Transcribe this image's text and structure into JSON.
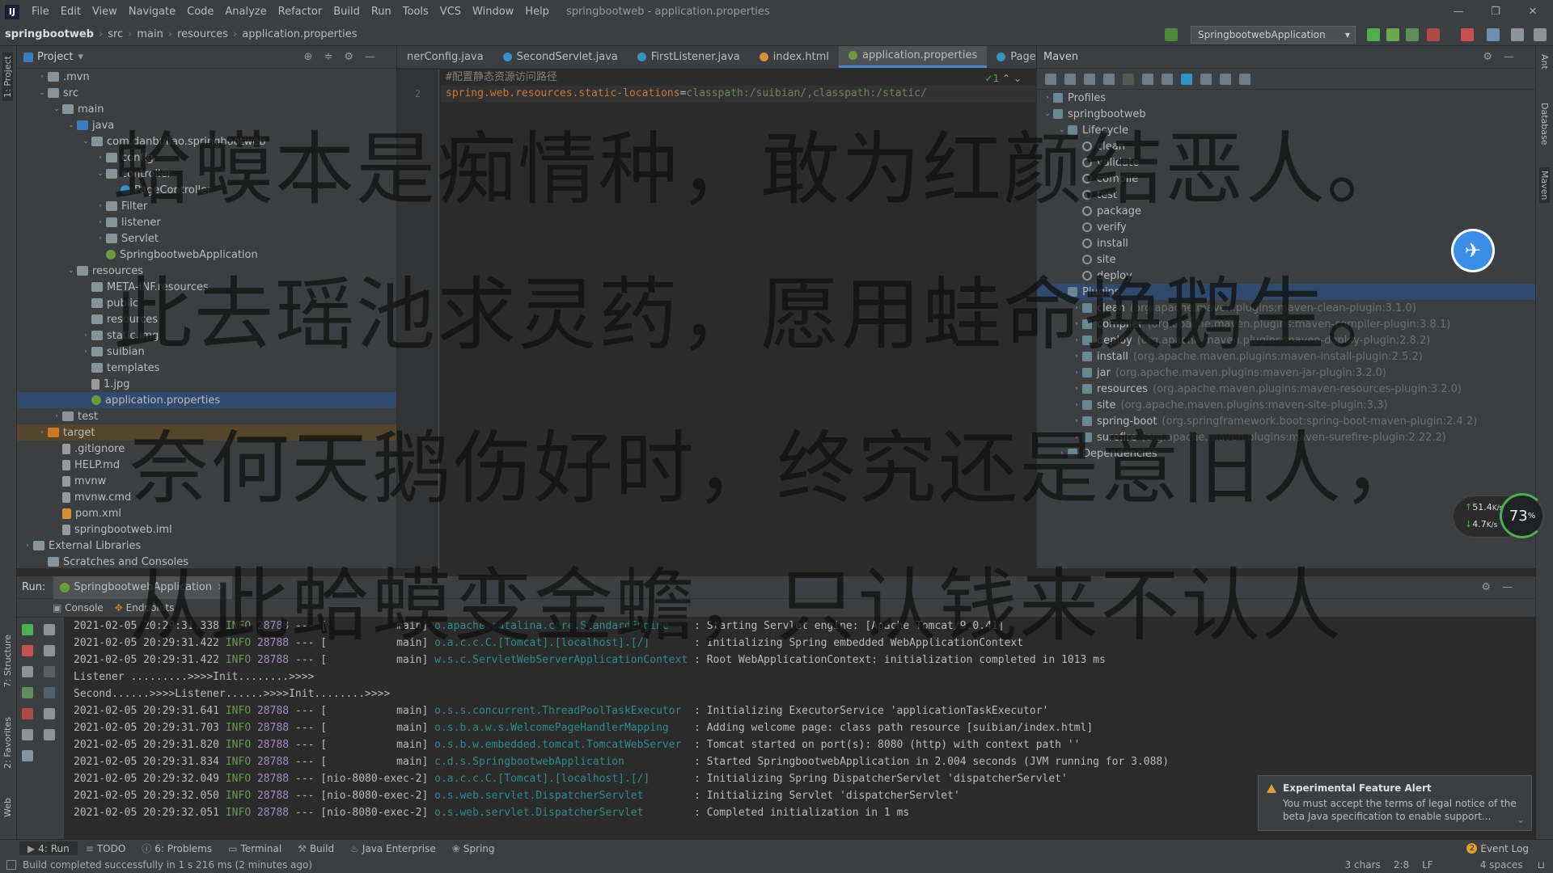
{
  "menubar": {
    "items": [
      "File",
      "Edit",
      "View",
      "Navigate",
      "Code",
      "Analyze",
      "Refactor",
      "Build",
      "Run",
      "Tools",
      "VCS",
      "Window",
      "Help"
    ],
    "window_title": "springbootweb - application.properties"
  },
  "navbar": {
    "breadcrumbs": [
      "springbootweb",
      "src",
      "main",
      "resources",
      "application.properties"
    ],
    "run_config": "SpringbootwebApplication"
  },
  "project": {
    "title": "Project",
    "rows": [
      {
        "label": ".mvn"
      },
      {
        "label": "src"
      },
      {
        "label": "main"
      },
      {
        "label": "java"
      },
      {
        "label": "com.danbuliao.springbootweb"
      },
      {
        "label": "config"
      },
      {
        "label": "controller"
      },
      {
        "label": "PageController"
      },
      {
        "label": "Filter"
      },
      {
        "label": "listener"
      },
      {
        "label": "Servlet"
      },
      {
        "label": "SpringbootwebApplication"
      },
      {
        "label": "resources"
      },
      {
        "label": "META-INF.resources"
      },
      {
        "label": "public"
      },
      {
        "label": "resources"
      },
      {
        "label": "static.img"
      },
      {
        "label": "suibian"
      },
      {
        "label": "templates"
      },
      {
        "label": "1.jpg"
      },
      {
        "label": "application.properties"
      },
      {
        "label": "test"
      },
      {
        "label": "target"
      },
      {
        "label": ".gitignore"
      },
      {
        "label": "HELP.md"
      },
      {
        "label": "mvnw"
      },
      {
        "label": "mvnw.cmd"
      },
      {
        "label": "pom.xml"
      },
      {
        "label": "springbootweb.iml"
      },
      {
        "label": "External Libraries"
      },
      {
        "label": "Scratches and Consoles"
      }
    ]
  },
  "editor": {
    "tabs": [
      "nerConfig.java",
      "SecondServlet.java",
      "FirstListener.java",
      "index.html",
      "application.properties",
      "PageC"
    ],
    "line1": "#配置静态资源访问路径",
    "line2_key": "spring.web.resources.static-locations",
    "line2_eq": "=",
    "line2_val": "classpath:/suibian/,classpath:/static/",
    "gutter": [
      "",
      "2"
    ],
    "inspection": "✓1"
  },
  "maven": {
    "title": "Maven",
    "rows": [
      {
        "label": "Profiles",
        "desc": ""
      },
      {
        "label": "springbootweb",
        "desc": ""
      },
      {
        "label": "Lifecycle",
        "desc": ""
      },
      {
        "label": "clean",
        "desc": ""
      },
      {
        "label": "validate",
        "desc": ""
      },
      {
        "label": "compile",
        "desc": ""
      },
      {
        "label": "test",
        "desc": ""
      },
      {
        "label": "package",
        "desc": ""
      },
      {
        "label": "verify",
        "desc": ""
      },
      {
        "label": "install",
        "desc": ""
      },
      {
        "label": "site",
        "desc": ""
      },
      {
        "label": "deploy",
        "desc": ""
      },
      {
        "label": "Plugins",
        "desc": ""
      },
      {
        "label": "clean",
        "desc": "(org.apache.maven.plugins:maven-clean-plugin:3.1.0)"
      },
      {
        "label": "compiler",
        "desc": "(org.apache.maven.plugins:maven-compiler-plugin:3.8.1)"
      },
      {
        "label": "deploy",
        "desc": "(org.apache.maven.plugins:maven-deploy-plugin:2.8.2)"
      },
      {
        "label": "install",
        "desc": "(org.apache.maven.plugins:maven-install-plugin:2.5.2)"
      },
      {
        "label": "jar",
        "desc": "(org.apache.maven.plugins:maven-jar-plugin:3.2.0)"
      },
      {
        "label": "resources",
        "desc": "(org.apache.maven.plugins:maven-resources-plugin:3.2.0)"
      },
      {
        "label": "site",
        "desc": "(org.apache.maven.plugins:maven-site-plugin:3.3)"
      },
      {
        "label": "spring-boot",
        "desc": "(org.springframework.boot:spring-boot-maven-plugin:2.4.2)"
      },
      {
        "label": "surefire",
        "desc": "(org.apache.maven.plugins:maven-surefire-plugin:2.22.2)"
      },
      {
        "label": "Dependencies",
        "desc": ""
      }
    ]
  },
  "run": {
    "label": "Run:",
    "config": "SpringbootwebApplication",
    "console_tab": "Console",
    "endpoints_tab": "Endpoints",
    "lines": [
      {
        "ts": "2021-02-05 20:29:31.338",
        "lvl": "INFO",
        "pid": "28788",
        "thread": "--- [           main]",
        "logger": "o.apache.catalina.core.StandardEngine   ",
        "msg": ": Starting Servlet engine: [Apache Tomcat/9.0.41]"
      },
      {
        "ts": "2021-02-05 20:29:31.422",
        "lvl": "INFO",
        "pid": "28788",
        "thread": "--- [           main]",
        "logger": "o.a.c.c.C.[Tomcat].[localhost].[/]      ",
        "msg": ": Initializing Spring embedded WebApplicationContext"
      },
      {
        "ts": "2021-02-05 20:29:31.422",
        "lvl": "INFO",
        "pid": "28788",
        "thread": "--- [           main]",
        "logger": "w.s.c.ServletWebServerApplicationContext",
        "msg": ": Root WebApplicationContext: initialization completed in 1013 ms"
      },
      {
        "plain": "Listener .........>>>>Init........>>>>"
      },
      {
        "plain": "Second......>>>>Listener......>>>>Init........>>>>"
      },
      {
        "ts": "2021-02-05 20:29:31.641",
        "lvl": "INFO",
        "pid": "28788",
        "thread": "--- [           main]",
        "logger": "o.s.s.concurrent.ThreadPoolTaskExecutor ",
        "msg": ": Initializing ExecutorService 'applicationTaskExecutor'"
      },
      {
        "ts": "2021-02-05 20:29:31.703",
        "lvl": "INFO",
        "pid": "28788",
        "thread": "--- [           main]",
        "logger": "o.s.b.a.w.s.WelcomePageHandlerMapping   ",
        "msg": ": Adding welcome page: class path resource [suibian/index.html]"
      },
      {
        "ts": "2021-02-05 20:29:31.820",
        "lvl": "INFO",
        "pid": "28788",
        "thread": "--- [           main]",
        "logger": "o.s.b.w.embedded.tomcat.TomcatWebServer ",
        "msg": ": Tomcat started on port(s): 8080 (http) with context path ''"
      },
      {
        "ts": "2021-02-05 20:29:31.834",
        "lvl": "INFO",
        "pid": "28788",
        "thread": "--- [           main]",
        "logger": "c.d.s.SpringbootwebApplication          ",
        "msg": ": Started SpringbootwebApplication in 2.004 seconds (JVM running for 3.088)"
      },
      {
        "ts": "2021-02-05 20:29:32.049",
        "lvl": "INFO",
        "pid": "28788",
        "thread": "--- [nio-8080-exec-2]",
        "logger": "o.a.c.c.C.[Tomcat].[localhost].[/]      ",
        "msg": ": Initializing Spring DispatcherServlet 'dispatcherServlet'"
      },
      {
        "ts": "2021-02-05 20:29:32.050",
        "lvl": "INFO",
        "pid": "28788",
        "thread": "--- [nio-8080-exec-2]",
        "logger": "o.s.web.servlet.DispatcherServlet       ",
        "msg": ": Initializing Servlet 'dispatcherServlet'"
      },
      {
        "ts": "2021-02-05 20:29:32.051",
        "lvl": "INFO",
        "pid": "28788",
        "thread": "--- [nio-8080-exec-2]",
        "logger": "o.s.web.servlet.DispatcherServlet       ",
        "msg": ": Completed initialization in 1 ms"
      }
    ]
  },
  "bottom_tabs": [
    "4: Run",
    "TODO",
    "6: Problems",
    "Terminal",
    "Build",
    "Java Enterprise",
    "Spring"
  ],
  "event_log": "Event Log",
  "event_count": "2",
  "status": {
    "message": "Build completed successfully in 1 s 216 ms (2 minutes ago)",
    "chars": "3 chars",
    "pos": "2:8",
    "eol": "LF",
    "indent": "4 spaces"
  },
  "alert": {
    "title": "Experimental Feature Alert",
    "body": "You must accept the terms of legal notice of the beta Java specification to enable support..."
  },
  "speed": {
    "up": "51.4",
    "up_unit": "K/s",
    "down": "4.7",
    "down_unit": "K/s",
    "percent": "73",
    "percent_sign": "%"
  },
  "side_tabs": {
    "project": "1: Project",
    "structure": "7: Structure",
    "favorites": "2: Favorites",
    "web": "Web",
    "ant": "Ant",
    "database": "Database",
    "maven": "Maven"
  },
  "poem": [
    "蛤蟆本是痴情种，敢为红颜结恶人。",
    "此去瑶池求灵药，愿用蛙命换鹅生。",
    "奈何天鹅伤好时，终究还是意旧人，",
    "从此蛤蟆变金蟾，只认钱来不认人"
  ]
}
